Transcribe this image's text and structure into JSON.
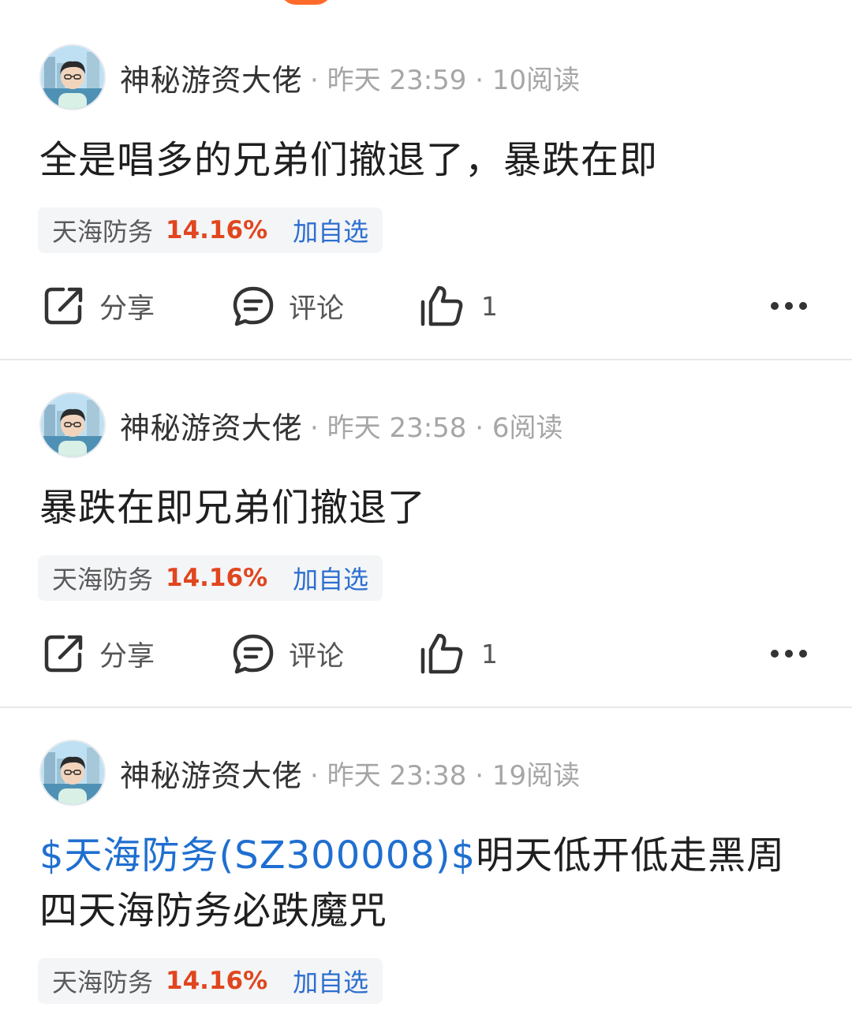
{
  "posts": [
    {
      "author": "神秘游资大佬",
      "meta": "· 昨天 23:59 · 10阅读",
      "text_link": "",
      "text": "全是唱多的兄弟们撤退了，暴跌在即",
      "stock": {
        "name": "天海防务",
        "change": "14.16%",
        "add_label": "加自选"
      },
      "actions": {
        "share": "分享",
        "comment": "评论",
        "likes": "1"
      }
    },
    {
      "author": "神秘游资大佬",
      "meta": "· 昨天 23:58 · 6阅读",
      "text_link": "",
      "text": "暴跌在即兄弟们撤退了",
      "stock": {
        "name": "天海防务",
        "change": "14.16%",
        "add_label": "加自选"
      },
      "actions": {
        "share": "分享",
        "comment": "评论",
        "likes": "1"
      }
    },
    {
      "author": "神秘游资大佬",
      "meta": "· 昨天 23:38 · 19阅读",
      "text_link": "$天海防务(SZ300008)$",
      "text": "明天低开低走黑周四天海防务必跌魔咒",
      "stock": {
        "name": "天海防务",
        "change": "14.16%",
        "add_label": "加自选"
      }
    }
  ],
  "colors": {
    "accent_blue": "#1f6fd0",
    "rise_red": "#e0461f",
    "meta_gray": "#a6a6a6",
    "chip_bg": "#f4f5f7"
  },
  "icons": [
    "share-icon",
    "comment-icon",
    "like-icon",
    "more-icon"
  ]
}
